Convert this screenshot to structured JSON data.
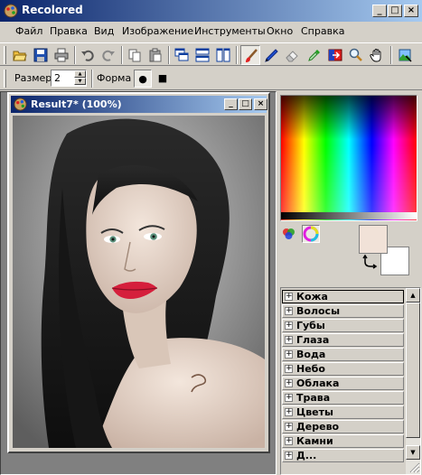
{
  "app": {
    "title": "Recolored"
  },
  "window_controls": {
    "minimize": "_",
    "maximize": "□",
    "close": "×"
  },
  "menu": [
    "Файл",
    "Правка",
    "Вид",
    "Изображение",
    "Инструменты",
    "Окно",
    "Справка"
  ],
  "toolbar": {
    "buttons": [
      "open-icon",
      "save-icon",
      "print-icon",
      "undo-icon",
      "redo-icon",
      "copy-icon",
      "paste-icon",
      "cascade-icon",
      "tile-horizontal-icon",
      "tile-vertical-icon",
      "brush-icon",
      "pencil-icon",
      "eraser-icon",
      "eyedropper-icon",
      "color-replace-icon",
      "zoom-icon",
      "hand-icon",
      "crop-image-icon"
    ],
    "active_tool": "brush-icon"
  },
  "options": {
    "size_label": "Размер",
    "size_value": "2",
    "shape_label": "Форма",
    "shapes": [
      "●",
      "■"
    ],
    "selected_shape": "●"
  },
  "document": {
    "title": "Result7* (100%)",
    "controls": {
      "minimize": "_",
      "maximize": "□",
      "close": "×"
    }
  },
  "colors": {
    "foreground": "#f1e2d8",
    "background": "#ffffff",
    "accent_title": "#0a246a",
    "title_gradient_end": "#a6caf0",
    "face": "#d4d0c8"
  },
  "parts": {
    "items": [
      "Кожа",
      "Волосы",
      "Губы",
      "Глаза",
      "Вода",
      "Небо",
      "Облака",
      "Трава",
      "Цветы",
      "Дерево",
      "Камни",
      "Д..."
    ],
    "selected": "Кожа"
  }
}
